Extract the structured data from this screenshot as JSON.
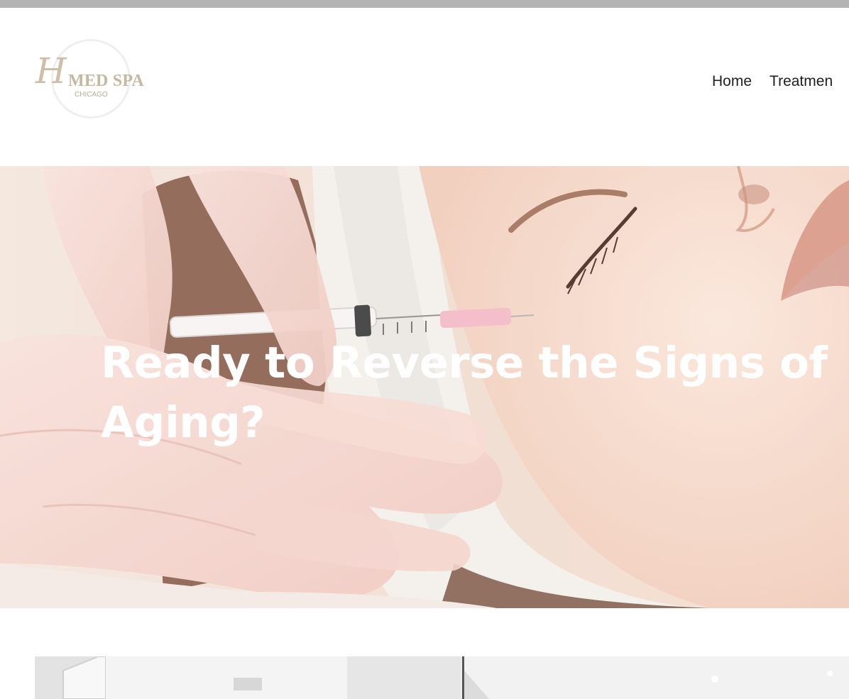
{
  "logo": {
    "monogram": "H",
    "name": "MED SPA",
    "city": "CHICAGO"
  },
  "nav": {
    "items": [
      "Home",
      "Treatmen"
    ]
  },
  "hero": {
    "title": "Ready to Reverse the Signs of Aging?"
  },
  "colors": {
    "top_strip": "#b3b3b3",
    "logo_gold": "#c7b79e",
    "nav_text": "#1f1f1f",
    "hero_title": "#ffffff"
  }
}
